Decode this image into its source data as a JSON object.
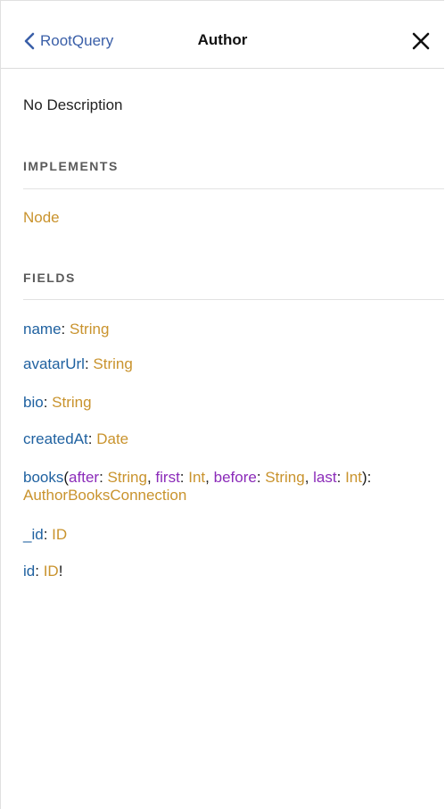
{
  "header": {
    "back_label": "RootQuery",
    "title": "Author"
  },
  "description": "No Description",
  "implements": {
    "section_title": "IMPLEMENTS",
    "items": [
      "Node"
    ]
  },
  "fields": {
    "section_title": "FIELDS",
    "items": [
      {
        "name": "name",
        "type": "String",
        "suffix": ""
      },
      {
        "name": "avatarUrl",
        "type": "String",
        "suffix": ""
      },
      {
        "name": "bio",
        "type": "String",
        "suffix": ""
      },
      {
        "name": "createdAt",
        "type": "Date",
        "suffix": ""
      },
      {
        "name": "books",
        "args": [
          {
            "name": "after",
            "type": "String"
          },
          {
            "name": "first",
            "type": "Int"
          },
          {
            "name": "before",
            "type": "String"
          },
          {
            "name": "last",
            "type": "Int"
          }
        ],
        "type": "AuthorBooksConnection",
        "suffix": ""
      },
      {
        "name": "_id",
        "type": "ID",
        "suffix": ""
      },
      {
        "name": "id",
        "type": "ID",
        "suffix": "!"
      }
    ]
  },
  "colors": {
    "field_name": "#1f61a0",
    "type": "#c9932d",
    "arg_name": "#8b2bb9",
    "back_link": "#3a5fa8"
  },
  "icons": {
    "back": "chevron-left-icon",
    "close": "close-icon"
  }
}
